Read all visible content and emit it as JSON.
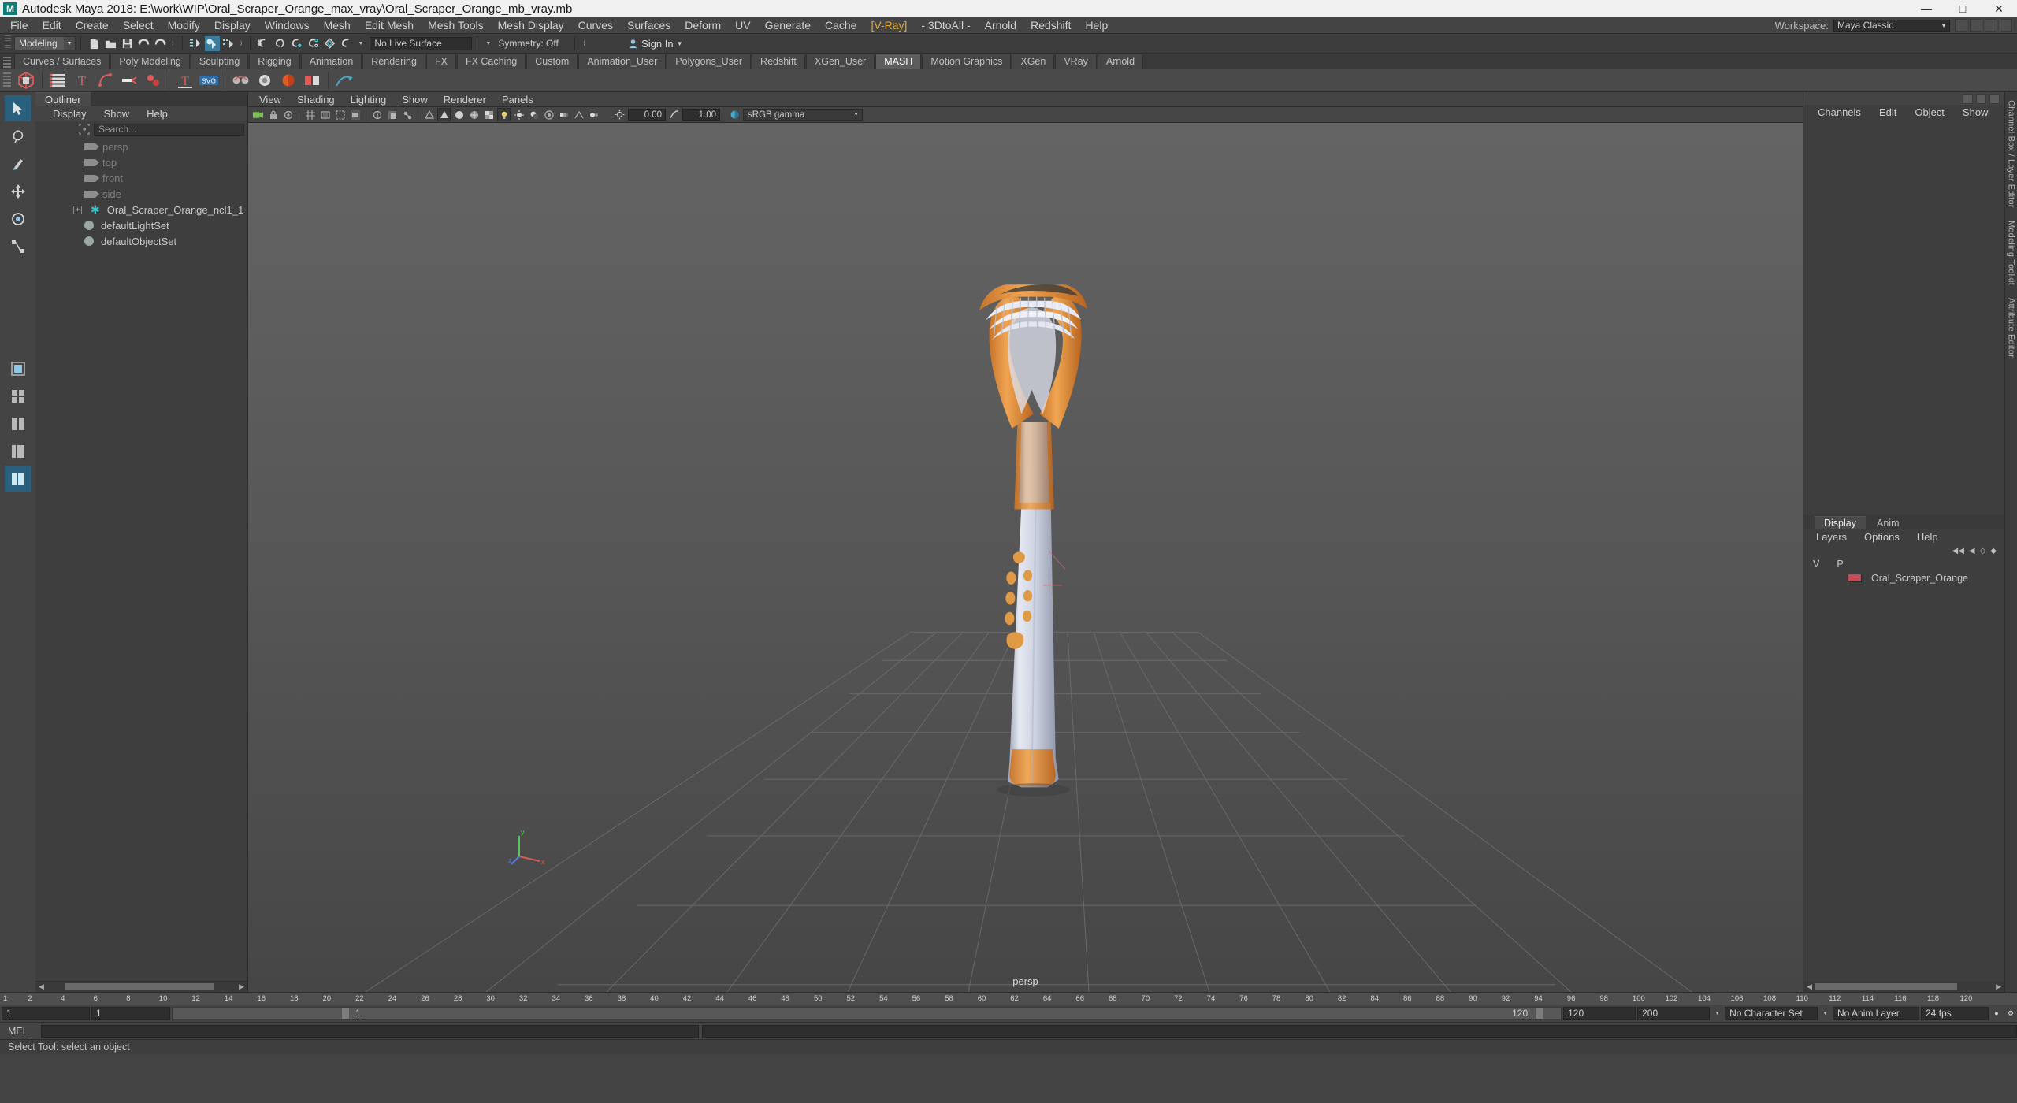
{
  "window": {
    "title": "Autodesk Maya 2018: E:\\work\\WIP\\Oral_Scraper_Orange_max_vray\\Oral_Scraper_Orange_mb_vray.mb",
    "logo": "M",
    "minimize": "—",
    "maximize": "□",
    "close": "✕"
  },
  "menubar": {
    "items": [
      "File",
      "Edit",
      "Create",
      "Select",
      "Modify",
      "Display",
      "Windows",
      "Mesh",
      "Edit Mesh",
      "Mesh Tools",
      "Mesh Display",
      "Curves",
      "Surfaces",
      "Deform",
      "UV",
      "Generate",
      "Cache",
      "[V-Ray]",
      "- 3DtoAll -",
      "Arnold",
      "Redshift",
      "Help"
    ],
    "workspace_label": "Workspace:",
    "workspace_value": "Maya Classic"
  },
  "statusline": {
    "menuset": "Modeling",
    "live_surface": "No Live Surface",
    "symmetry": "Symmetry: Off",
    "signin": "Sign In",
    "icons": [
      "new-scene-icon",
      "open-scene-icon",
      "save-scene-icon",
      "undo-icon",
      "redo-icon",
      "select-hierarchy-icon",
      "select-object-icon",
      "select-component-icon",
      "snap-grid-icon",
      "snap-curve-icon",
      "snap-point-icon",
      "snap-projected-icon",
      "snap-view-plane-icon",
      "make-live-icon"
    ]
  },
  "shelf": {
    "tabs": [
      "Curves / Surfaces",
      "Poly Modeling",
      "Sculpting",
      "Rigging",
      "Animation",
      "Rendering",
      "FX",
      "FX Caching",
      "Custom",
      "Animation_User",
      "Polygons_User",
      "Redshift",
      "XGen_User",
      "MASH",
      "Motion Graphics",
      "XGen",
      "VRay",
      "Arnold"
    ],
    "selected": "MASH"
  },
  "outliner": {
    "tab": "Outliner",
    "menus": [
      "Display",
      "Show",
      "Help"
    ],
    "search_placeholder": "Search...",
    "items": [
      {
        "label": "persp",
        "icon": "camera-icon",
        "dim": true,
        "expandable": false
      },
      {
        "label": "top",
        "icon": "camera-icon",
        "dim": true,
        "expandable": false
      },
      {
        "label": "front",
        "icon": "camera-icon",
        "dim": true,
        "expandable": false
      },
      {
        "label": "side",
        "icon": "camera-icon",
        "dim": true,
        "expandable": false
      },
      {
        "label": "Oral_Scraper_Orange_ncl1_1",
        "icon": "mesh-icon",
        "dim": false,
        "expandable": true
      },
      {
        "label": "defaultLightSet",
        "icon": "set-icon",
        "dim": false,
        "expandable": false
      },
      {
        "label": "defaultObjectSet",
        "icon": "set-icon",
        "dim": false,
        "expandable": false
      }
    ]
  },
  "viewport": {
    "menus": [
      "View",
      "Shading",
      "Lighting",
      "Show",
      "Renderer",
      "Panels"
    ],
    "exposure": "0.00",
    "gamma_value": "1.00",
    "color_management": "sRGB gamma",
    "camera_label": "persp",
    "axis": {
      "x": "x",
      "y": "y",
      "z": "z"
    }
  },
  "channelbox": {
    "menus": [
      "Channels",
      "Edit",
      "Object",
      "Show"
    ],
    "side_tabs": [
      "Channel Box / Layer Editor",
      "Modeling Toolkit",
      "Attribute Editor"
    ]
  },
  "layers": {
    "tabs": [
      "Display",
      "Anim"
    ],
    "selected_tab": "Display",
    "menus": [
      "Layers",
      "Options",
      "Help"
    ],
    "headers": [
      "V",
      "P"
    ],
    "rows": [
      {
        "v": "",
        "p": "",
        "color": "#c8455c",
        "name": "Oral_Scraper_Orange"
      }
    ]
  },
  "timeslider": {
    "ticks": [
      "2",
      "4",
      "6",
      "8",
      "10",
      "12",
      "14",
      "16",
      "18",
      "20",
      "22",
      "24",
      "26",
      "28",
      "30",
      "32",
      "34",
      "36",
      "38",
      "40",
      "42",
      "44",
      "46",
      "48",
      "50",
      "52",
      "54",
      "56",
      "58",
      "60",
      "62",
      "64",
      "66",
      "68",
      "70",
      "72",
      "74",
      "76",
      "78",
      "80",
      "82",
      "84",
      "86",
      "88",
      "90",
      "92",
      "94",
      "96",
      "98",
      "100",
      "102",
      "104",
      "106",
      "108",
      "110",
      "112",
      "114",
      "116",
      "118",
      "120"
    ],
    "current_frame_left": "1",
    "range_start": "1",
    "range_start2": "1",
    "key_frame": "1",
    "range_end_inner": "120",
    "playback_start": "120",
    "playback_end": "200",
    "character_set": "No Character Set",
    "anim_layer": "No Anim Layer",
    "fps": "24 fps",
    "frame_field": "1"
  },
  "commandline": {
    "label": "MEL",
    "value": ""
  },
  "helpline": {
    "text": "Select Tool: select an object"
  }
}
